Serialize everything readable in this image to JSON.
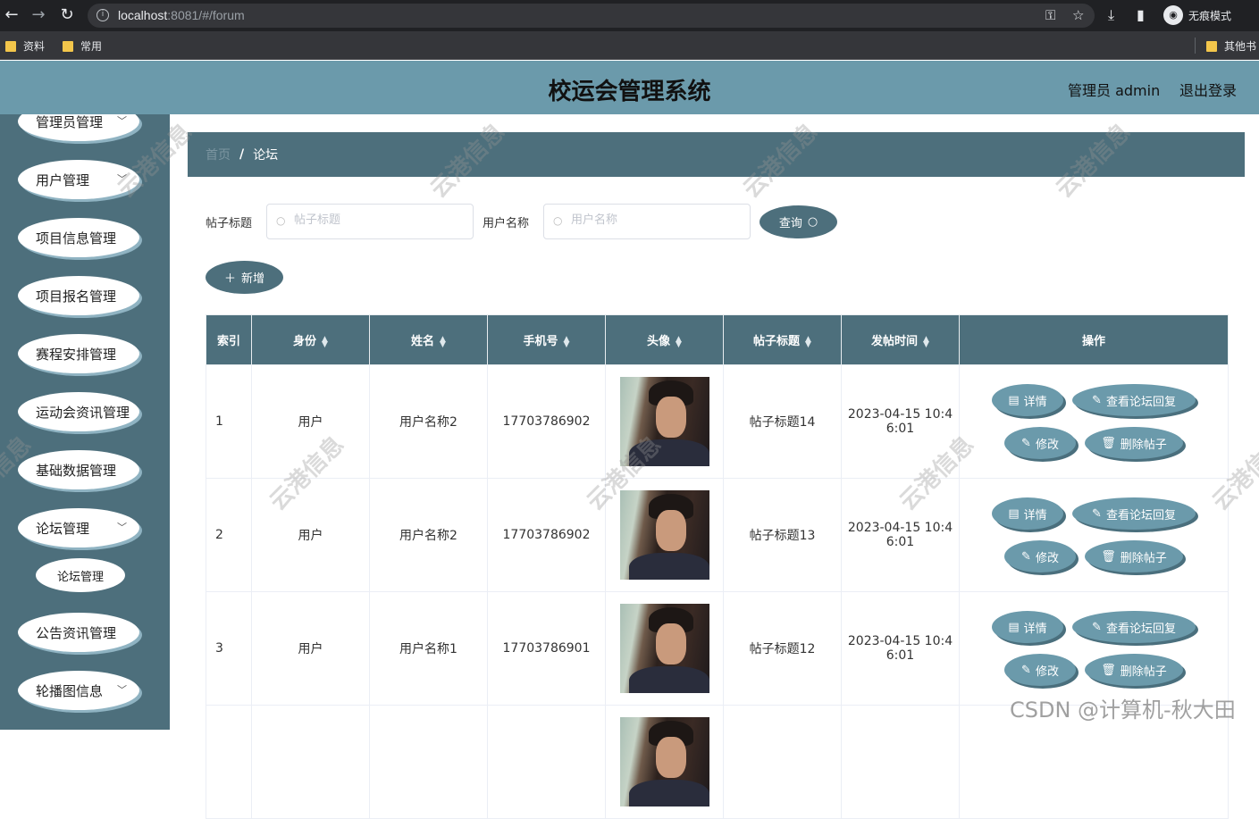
{
  "browser": {
    "url_host": "localhost",
    "url_rest": ":8081/#/forum",
    "incognito_label": "无痕模式",
    "bookmarks": [
      "资料",
      "常用"
    ],
    "other_bookmarks": "其他书"
  },
  "header": {
    "title": "校运会管理系统",
    "user": "管理员 admin",
    "logout": "退出登录"
  },
  "sidebar": {
    "items": [
      {
        "label": "管理员管理",
        "chevron": true
      },
      {
        "label": "用户管理",
        "chevron": true
      },
      {
        "label": "项目信息管理",
        "chevron": false
      },
      {
        "label": "项目报名管理",
        "chevron": false
      },
      {
        "label": "赛程安排管理",
        "chevron": false
      },
      {
        "label": "运动会资讯管理",
        "chevron": false
      },
      {
        "label": "基础数据管理",
        "chevron": false
      },
      {
        "label": "论坛管理",
        "chevron": true
      },
      {
        "label": "公告资讯管理",
        "chevron": false
      },
      {
        "label": "轮播图信息",
        "chevron": true
      }
    ],
    "submenu": "论坛管理"
  },
  "breadcrumb": {
    "home": "首页",
    "sep": "/",
    "current": "论坛"
  },
  "search": {
    "title_label": "帖子标题",
    "title_placeholder": "帖子标题",
    "user_label": "用户名称",
    "user_placeholder": "用户名称",
    "query_button": "查询",
    "add_button": "新增"
  },
  "table": {
    "columns": [
      "索引",
      "身份",
      "姓名",
      "手机号",
      "头像",
      "帖子标题",
      "发帖时间",
      "操作"
    ],
    "rows": [
      {
        "index": "1",
        "role": "用户",
        "name": "用户名称2",
        "phone": "17703786902",
        "title": "帖子标题14",
        "time": "2023-04-15 10:4",
        "time2": "6:01"
      },
      {
        "index": "2",
        "role": "用户",
        "name": "用户名称2",
        "phone": "17703786902",
        "title": "帖子标题13",
        "time": "2023-04-15 10:4",
        "time2": "6:01"
      },
      {
        "index": "3",
        "role": "用户",
        "name": "用户名称1",
        "phone": "17703786901",
        "title": "帖子标题12",
        "time": "2023-04-15 10:4",
        "time2": "6:01"
      }
    ],
    "actions": {
      "detail": "详情",
      "view_reply": "查看论坛回复",
      "edit": "修改",
      "delete": "删除帖子"
    }
  },
  "watermark": "CSDN @计算机-秋大田",
  "watermark_brand": "云港信息",
  "colors": {
    "header": "#6b9aab",
    "sidebar": "#4d6f7c",
    "button": "#6b9aab"
  }
}
